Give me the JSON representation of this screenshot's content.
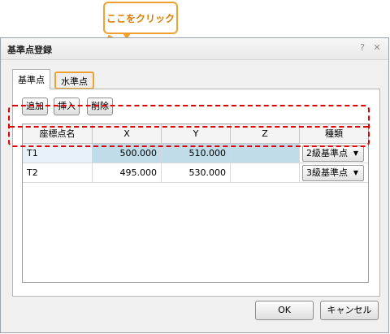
{
  "callout": {
    "text": "ここをクリック"
  },
  "window": {
    "title": "基準点登録",
    "help_glyph": "?",
    "close_glyph": "✕"
  },
  "tabs": [
    {
      "label": "基準点",
      "active": true
    },
    {
      "label": "水準点",
      "active": false
    }
  ],
  "toolbar": {
    "add": "追加",
    "insert": "挿入",
    "delete": "削除"
  },
  "grid": {
    "columns": [
      "座標点名",
      "X",
      "Y",
      "Z",
      "種類"
    ],
    "rows": [
      {
        "name": "T1",
        "x": "500.000",
        "y": "510.000",
        "z": "",
        "type": "2級基準点"
      },
      {
        "name": "T2",
        "x": "495.000",
        "y": "530.000",
        "z": "",
        "type": "3級基準点"
      }
    ]
  },
  "footer": {
    "ok": "OK",
    "cancel": "キャンセル"
  },
  "colors": {
    "highlight": "#f0a030",
    "dashed_box": "#e00000",
    "selection": "#bfdce8"
  },
  "icons": [
    "pointing-hand-icon",
    "help-icon",
    "close-icon",
    "chevron-down-icon"
  ]
}
